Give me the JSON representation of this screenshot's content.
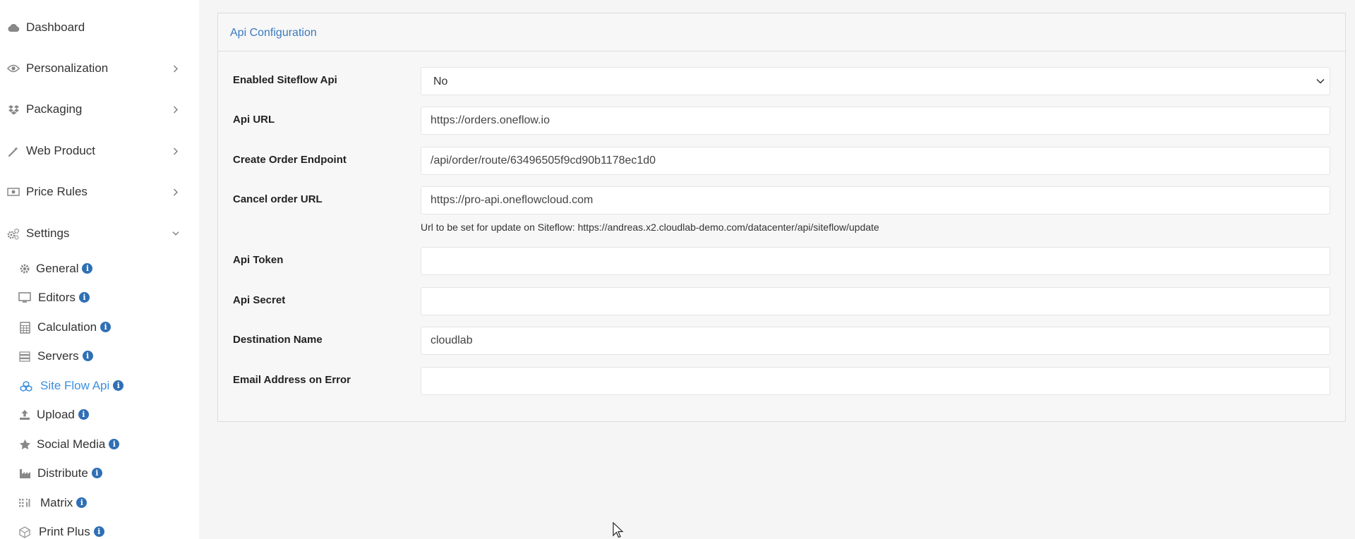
{
  "sidebar": {
    "items": [
      {
        "label": "Dashboard",
        "icon": "cloud-icon"
      },
      {
        "label": "Personalization",
        "icon": "eye-icon"
      },
      {
        "label": "Packaging",
        "icon": "dropbox-icon"
      },
      {
        "label": "Web Product",
        "icon": "magic-wand-icon"
      },
      {
        "label": "Price Rules",
        "icon": "money-icon"
      },
      {
        "label": "Settings",
        "icon": "cogs-icon"
      }
    ],
    "settings_items": [
      {
        "label": "General",
        "icon": "gear-icon"
      },
      {
        "label": "Editors",
        "icon": "desktop-icon"
      },
      {
        "label": "Calculation",
        "icon": "calculator-icon"
      },
      {
        "label": "Servers",
        "icon": "server-icon"
      },
      {
        "label": "Site Flow Api",
        "icon": "cubes-icon"
      },
      {
        "label": "Upload",
        "icon": "upload-icon"
      },
      {
        "label": "Social Media",
        "icon": "star-icon"
      },
      {
        "label": "Distribute",
        "icon": "industry-icon"
      },
      {
        "label": "Matrix",
        "icon": "grid-icon"
      },
      {
        "label": "Print Plus",
        "icon": "cube-outline-icon"
      }
    ],
    "active_item": "Site Flow Api",
    "active_color": "#3b8fe0"
  },
  "panel": {
    "title": "Api Configuration",
    "fields": {
      "enabled": {
        "label": "Enabled Siteflow Api",
        "value": "No"
      },
      "api_url": {
        "label": "Api URL",
        "value": "https://orders.oneflow.io"
      },
      "create_order": {
        "label": "Create Order Endpoint",
        "value": "/api/order/route/63496505f9cd90b1178ec1d0"
      },
      "cancel_order": {
        "label": "Cancel order URL",
        "value": "https://pro-api.oneflowcloud.com",
        "help": "Url to be set for update on Siteflow: https://andreas.x2.cloudlab-demo.com/datacenter/api/siteflow/update"
      },
      "api_token": {
        "label": "Api Token",
        "value": ""
      },
      "api_secret": {
        "label": "Api Secret",
        "value": ""
      },
      "destination": {
        "label": "Destination Name",
        "value": "cloudlab"
      },
      "email_error": {
        "label": "Email Address on Error",
        "value": ""
      }
    }
  },
  "colors": {
    "title_blue": "#3a7abf",
    "info_badge": "#2f6fb5"
  }
}
